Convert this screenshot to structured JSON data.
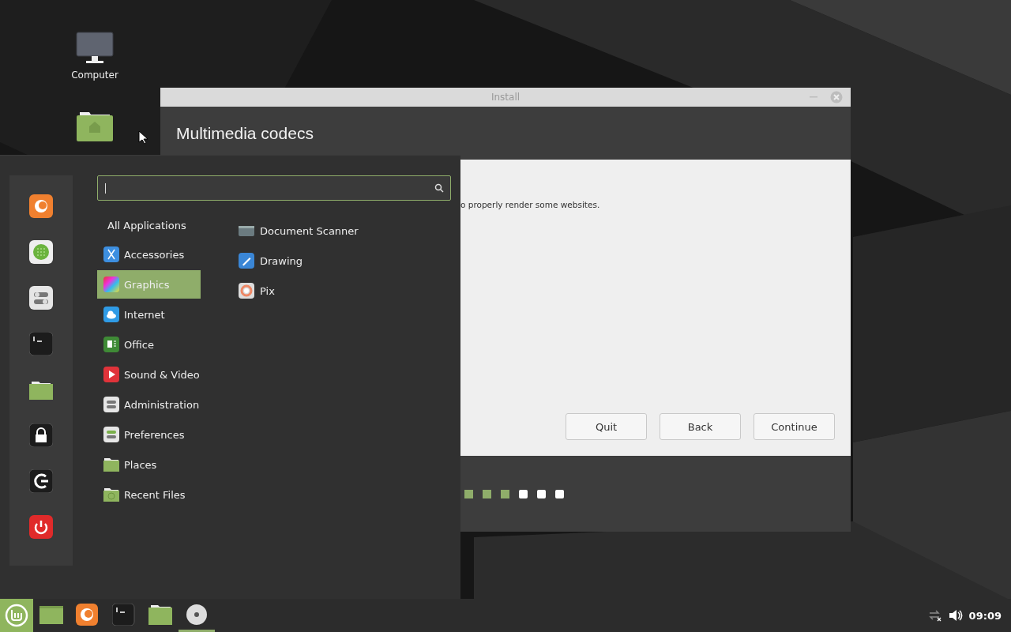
{
  "desktop_icons": [
    {
      "kind": "computer",
      "label": "Computer"
    },
    {
      "kind": "home"
    }
  ],
  "install_window": {
    "title": "Install",
    "heading": "Multimedia codecs",
    "body_text": "o properly render some websites.",
    "buttons": [
      "Quit",
      "Back",
      "Continue"
    ],
    "steps": [
      {
        "done": true
      },
      {
        "done": true
      },
      {
        "done": true
      },
      {
        "done": false
      },
      {
        "done": false
      },
      {
        "done": false
      }
    ]
  },
  "menu": {
    "categories": [
      {
        "label": "All Applications",
        "selected": false
      },
      {
        "label": "Accessories",
        "selected": false
      },
      {
        "label": "Graphics",
        "selected": true
      },
      {
        "label": "Internet",
        "selected": false
      },
      {
        "label": "Office",
        "selected": false
      },
      {
        "label": "Sound & Video",
        "selected": false
      },
      {
        "label": "Administration",
        "selected": false
      },
      {
        "label": "Preferences",
        "selected": false
      },
      {
        "label": "Places",
        "selected": false
      },
      {
        "label": "Recent Files",
        "selected": false
      }
    ],
    "apps": [
      "Document Scanner",
      "Drawing",
      "Pix"
    ]
  },
  "taskbar": {
    "items": [
      {
        "active": false
      },
      {
        "active": false
      },
      {
        "active": false
      },
      {
        "active": false
      },
      {
        "active": true
      }
    ],
    "clock": "09:09"
  }
}
